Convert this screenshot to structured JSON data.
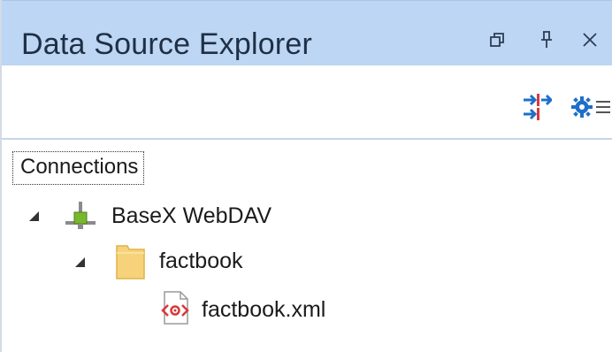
{
  "panel": {
    "title": "Data Source Explorer",
    "title_buttons": [
      {
        "name": "restore-window-icon"
      },
      {
        "name": "pin-icon"
      },
      {
        "name": "close-icon"
      }
    ]
  },
  "toolbar": {
    "buttons": [
      {
        "name": "configure-connections-icon"
      },
      {
        "name": "settings-icon"
      }
    ]
  },
  "tree": {
    "root_label": "Connections",
    "nodes": [
      {
        "label": "BaseX WebDAV",
        "level": 0,
        "expanded": true,
        "icon": "network-connection-icon"
      },
      {
        "label": "factbook",
        "level": 1,
        "expanded": true,
        "icon": "folder-icon"
      },
      {
        "label": "factbook.xml",
        "level": 2,
        "expanded": false,
        "icon": "xml-file-icon"
      }
    ]
  },
  "colors": {
    "title_bar": "#bcd6f3",
    "title_text": "#1f2f45",
    "accent_blue": "#1e6fc9",
    "accent_red": "#d8383a",
    "folder": "#f6d37a",
    "connection_green": "#79b82d"
  }
}
